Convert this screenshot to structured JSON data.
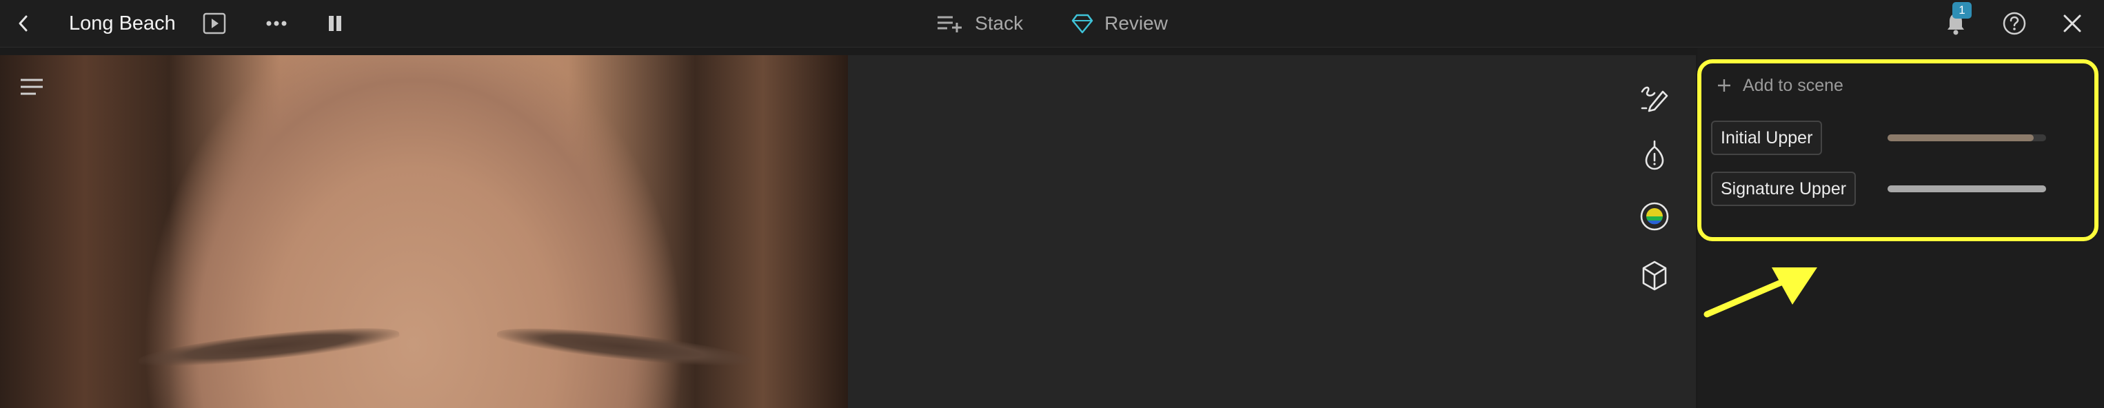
{
  "app": {
    "title": "Long Beach",
    "notifications_count": "1"
  },
  "center_tabs": [
    {
      "label": "Stack",
      "icon": "stack-add-icon"
    },
    {
      "label": "Review",
      "icon": "diamond-icon"
    }
  ],
  "panel": {
    "add_scene_label": "Add to scene",
    "scenes": [
      {
        "label": "Initial Upper",
        "slider_fraction": 0.92,
        "slider_color": "#8c7b6a"
      },
      {
        "label": "Signature Upper",
        "slider_fraction": 1.0,
        "slider_color": "#a8a8a8"
      }
    ]
  },
  "colors": {
    "highlight": "#ffff3b",
    "badge": "#2f8fb6"
  }
}
